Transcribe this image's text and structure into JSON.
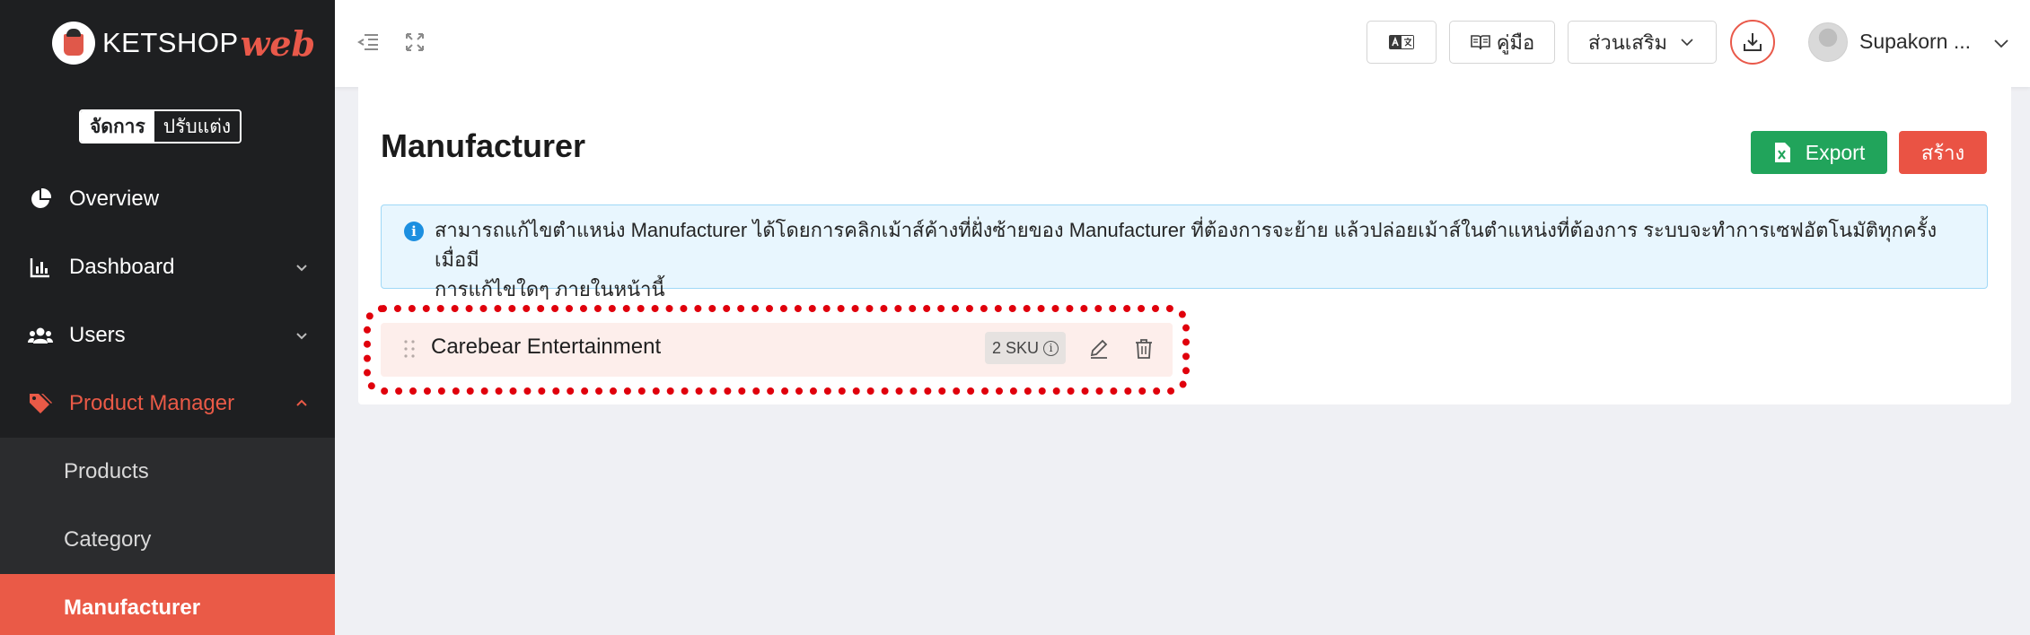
{
  "brand": {
    "name_main": "KETSHOP",
    "name_accent": "web"
  },
  "mode_toggle": {
    "active": "จัดการ",
    "inactive": "ปรับแต่ง"
  },
  "sidebar": {
    "items": [
      {
        "label": "Overview",
        "icon": "pie-chart-icon"
      },
      {
        "label": "Dashboard",
        "icon": "bar-chart-icon"
      },
      {
        "label": "Users",
        "icon": "users-icon"
      },
      {
        "label": "Product Manager",
        "icon": "tags-icon"
      }
    ],
    "sub_items": [
      {
        "label": "Products"
      },
      {
        "label": "Category"
      },
      {
        "label": "Manufacturer"
      }
    ]
  },
  "topbar": {
    "manual_label": "คู่มือ",
    "addons_label": "ส่วนเสริม",
    "user_name": "Supakorn ..."
  },
  "page": {
    "title": "Manufacturer",
    "export_label": "Export",
    "create_label": "สร้าง",
    "info_line1": "สามารถแก้ไขตำแหน่ง Manufacturer ได้โดยการคลิกเม้าส์ค้างที่ฝั่งซ้ายของ Manufacturer ที่ต้องการจะย้าย แล้วปล่อยเม้าส์ในตำแหน่งที่ต้องการ ระบบจะทำการเซฟอัตโนมัติทุกครั้งเมื่อมี",
    "info_line2": "การแก้ไขใดๆ ภายในหน้านี้"
  },
  "manufacturers": [
    {
      "name": "Carebear Entertainment",
      "sku": "2 SKU"
    }
  ],
  "colors": {
    "accent": "#ea5a47",
    "sidebar_bg": "#1e1f21",
    "export_green": "#21a45b",
    "highlight_red": "#e0000c"
  }
}
